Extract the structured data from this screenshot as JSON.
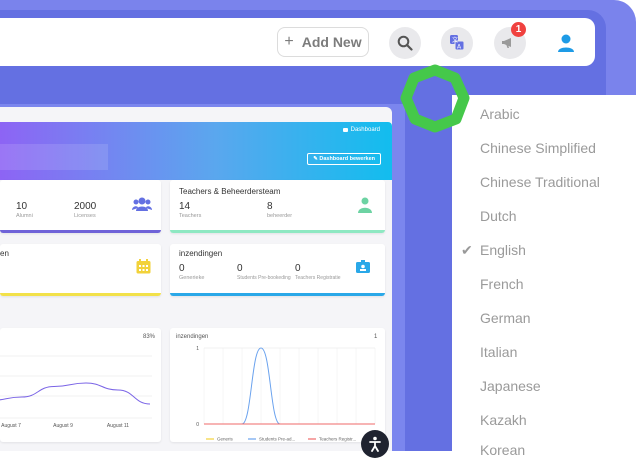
{
  "header": {
    "add_new_label": "Add New",
    "add_new_icon": "plus-icon",
    "notification_count": "1"
  },
  "dashboard": {
    "hero_title": "Dashboard",
    "hero_button": "Dashboard bewerken",
    "cards": {
      "alumni_value": "10",
      "alumni_label": "Alumni",
      "licenses_value": "2000",
      "licenses_label": "Licenses",
      "teachers_card_title": "Teachers & Beheerdersteam",
      "teachers_value": "14",
      "teachers_label": "Teachers",
      "beheerder_value": "8",
      "beheerder_label": "beheerder",
      "left_partial_title": "en",
      "inzendingen_title": "inzendingen",
      "generieke_value": "0",
      "generieke_label": "Generieke",
      "students_value": "0",
      "students_label": "Students Pre-bookeding",
      "teachers_reg_value": "0",
      "teachers_reg_label": "Teachers Registratie"
    },
    "chart_left": {
      "percent": "83%",
      "x_ticks": [
        "August 7",
        "August 9",
        "August 11"
      ]
    },
    "chart_right": {
      "title": "inzendingen",
      "count": "1",
      "y_ticks": [
        "1",
        "0"
      ],
      "legend": [
        "Generis",
        "Students Pre-ad...",
        "Teachers Registr..."
      ]
    }
  },
  "chart_data": [
    {
      "type": "line",
      "x": [
        "",
        "August 7",
        "",
        "August 9",
        "",
        "August 11"
      ],
      "series": [
        {
          "values": [
            0.25,
            0.3,
            0.45,
            0.5,
            0.4,
            0.2
          ]
        }
      ],
      "color": "#7a64e6"
    },
    {
      "type": "line",
      "title": "inzendingen",
      "categories": [
        "",
        "",
        "",
        "",
        "",
        "",
        "",
        "",
        "",
        ""
      ],
      "series": [
        {
          "name": "Generis",
          "values": [
            0,
            0,
            0,
            0,
            0,
            0,
            0,
            0,
            0,
            0
          ]
        },
        {
          "name": "Students Pre-ad...",
          "values": [
            0,
            0,
            0,
            1,
            0,
            0,
            0,
            0,
            0,
            0
          ]
        },
        {
          "name": "Teachers Registr...",
          "values": [
            0,
            0,
            0,
            0,
            0,
            0,
            0,
            0,
            0,
            0
          ]
        }
      ],
      "ylim": [
        0,
        1
      ],
      "colors": [
        "#f2d23a",
        "#6aa2ee",
        "#ef6a6a"
      ]
    }
  ],
  "language_menu": {
    "selected": "English",
    "items": [
      "Arabic",
      "Chinese Simplified",
      "Chinese Traditional",
      "Dutch",
      "English",
      "French",
      "German",
      "Italian",
      "Japanese",
      "Kazakh",
      "Korean"
    ]
  },
  "colors": {
    "brand": "#6470e2",
    "cursor_green": "#45c84a"
  }
}
